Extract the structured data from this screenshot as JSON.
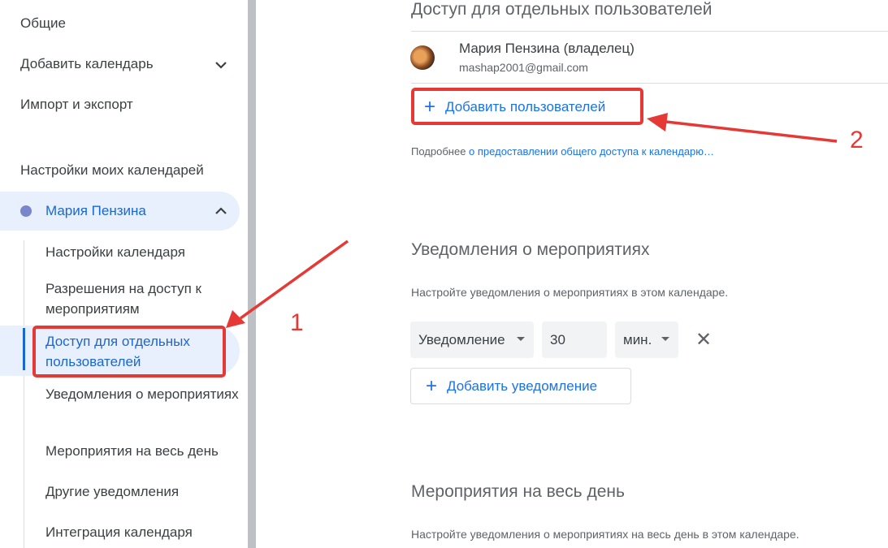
{
  "sidebar": {
    "general": "Общие",
    "add_calendar": "Добавить календарь",
    "import_export": "Импорт и экспорт",
    "my_calendars_header": "Настройки моих календарей",
    "calendar_name": "Мария Пензина",
    "calendar_color": "#7986cb",
    "sub_items": [
      "Настройки календаря",
      "Разрешения на доступ к мероприятиям",
      "Доступ для отдельных пользователей",
      "Уведомления о мероприятиях",
      "Мероприятия на весь день",
      "Другие уведомления",
      "Интеграция календаря"
    ],
    "active_item_index": 2
  },
  "sharing": {
    "title": "Доступ для отдельных пользователей",
    "owner_name": "Мария Пензина (владелец)",
    "owner_email": "mashap2001@gmail.com",
    "add_users_label": "Добавить пользователей",
    "more_info_prefix": "Подробнее",
    "more_info_link": "о предоставлении общего доступа к календарю…"
  },
  "event_notifications": {
    "title": "Уведомления о мероприятиях",
    "description": "Настройте уведомления о мероприятиях в этом календаре.",
    "type_value": "Уведомление",
    "amount_value": "30",
    "unit_value": "мин.",
    "add_label": "Добавить уведомление"
  },
  "all_day": {
    "title": "Мероприятия на весь день",
    "description": "Настройте уведомления о мероприятиях на весь день в этом календаре."
  },
  "annotations": {
    "num1": "1",
    "num2": "2",
    "color": "#e53935"
  },
  "icons": {
    "add": "plus-icon",
    "expand": "chevron-down-icon",
    "collapse": "chevron-up-icon",
    "remove": "close-icon",
    "dropdown": "caret-down-icon"
  }
}
